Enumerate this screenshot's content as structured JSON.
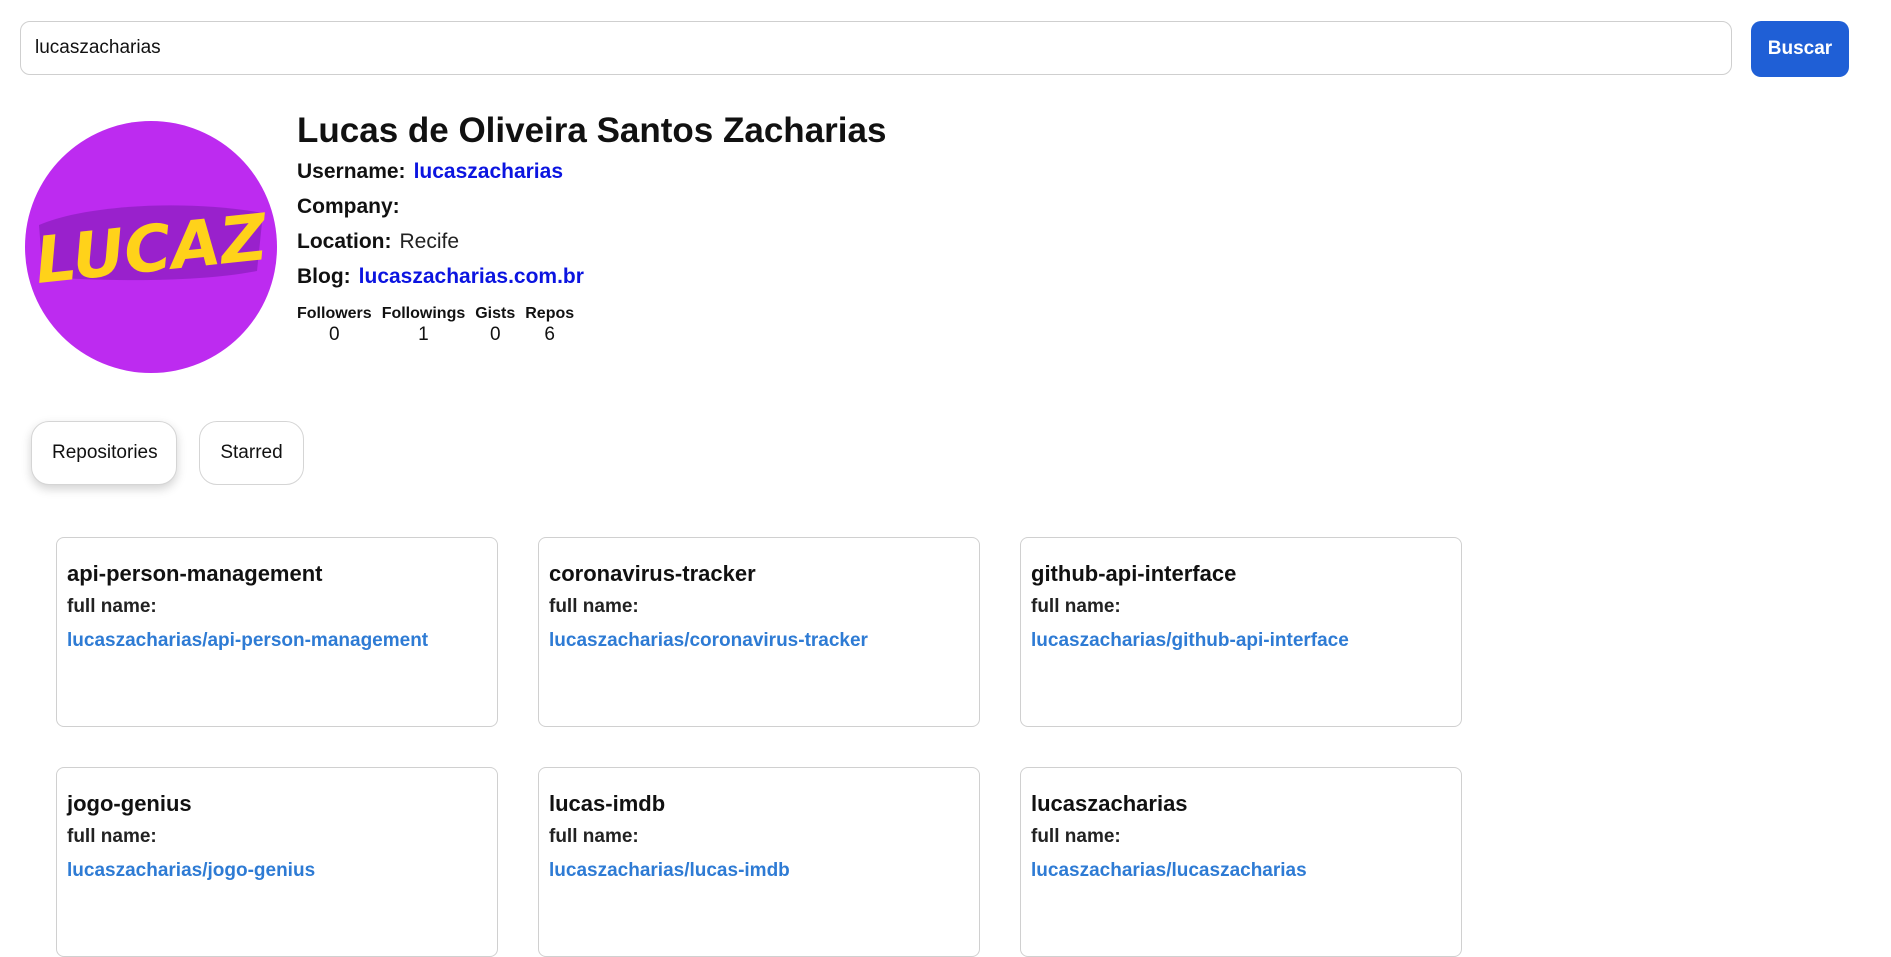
{
  "search": {
    "value": "lucaszacharias",
    "button_label": "Buscar"
  },
  "profile": {
    "avatar_text": "LUCAZ",
    "name": "Lucas de Oliveira Santos Zacharias",
    "username_label": "Username:",
    "username": "lucaszacharias",
    "company_label": "Company:",
    "company": "",
    "location_label": "Location:",
    "location": "Recife",
    "blog_label": "Blog:",
    "blog": "lucaszacharias.com.br",
    "stats": [
      {
        "label": "Followers",
        "value": "0"
      },
      {
        "label": "Followings",
        "value": "1"
      },
      {
        "label": "Gists",
        "value": "0"
      },
      {
        "label": "Repos",
        "value": "6"
      }
    ]
  },
  "tabs": [
    {
      "label": "Repositories",
      "active": true
    },
    {
      "label": "Starred",
      "active": false
    }
  ],
  "repos": [
    {
      "name": "api-person-management",
      "full_name_label": "full name:",
      "full_name": "lucaszacharias/api-person-management"
    },
    {
      "name": "coronavirus-tracker",
      "full_name_label": "full name:",
      "full_name": "lucaszacharias/coronavirus-tracker"
    },
    {
      "name": "github-api-interface",
      "full_name_label": "full name:",
      "full_name": "lucaszacharias/github-api-interface"
    },
    {
      "name": "jogo-genius",
      "full_name_label": "full name:",
      "full_name": "lucaszacharias/jogo-genius"
    },
    {
      "name": "lucas-imdb",
      "full_name_label": "full name:",
      "full_name": "lucaszacharias/lucas-imdb"
    },
    {
      "name": "lucaszacharias",
      "full_name_label": "full name:",
      "full_name": "lucaszacharias/lucaszacharias"
    }
  ],
  "colors": {
    "primary_button": "#1f5fd6",
    "avatar_bg": "#bd2bf0",
    "avatar_text": "#ffd21a",
    "link": "#0b14e0",
    "repo_link": "#2e7bd4"
  }
}
